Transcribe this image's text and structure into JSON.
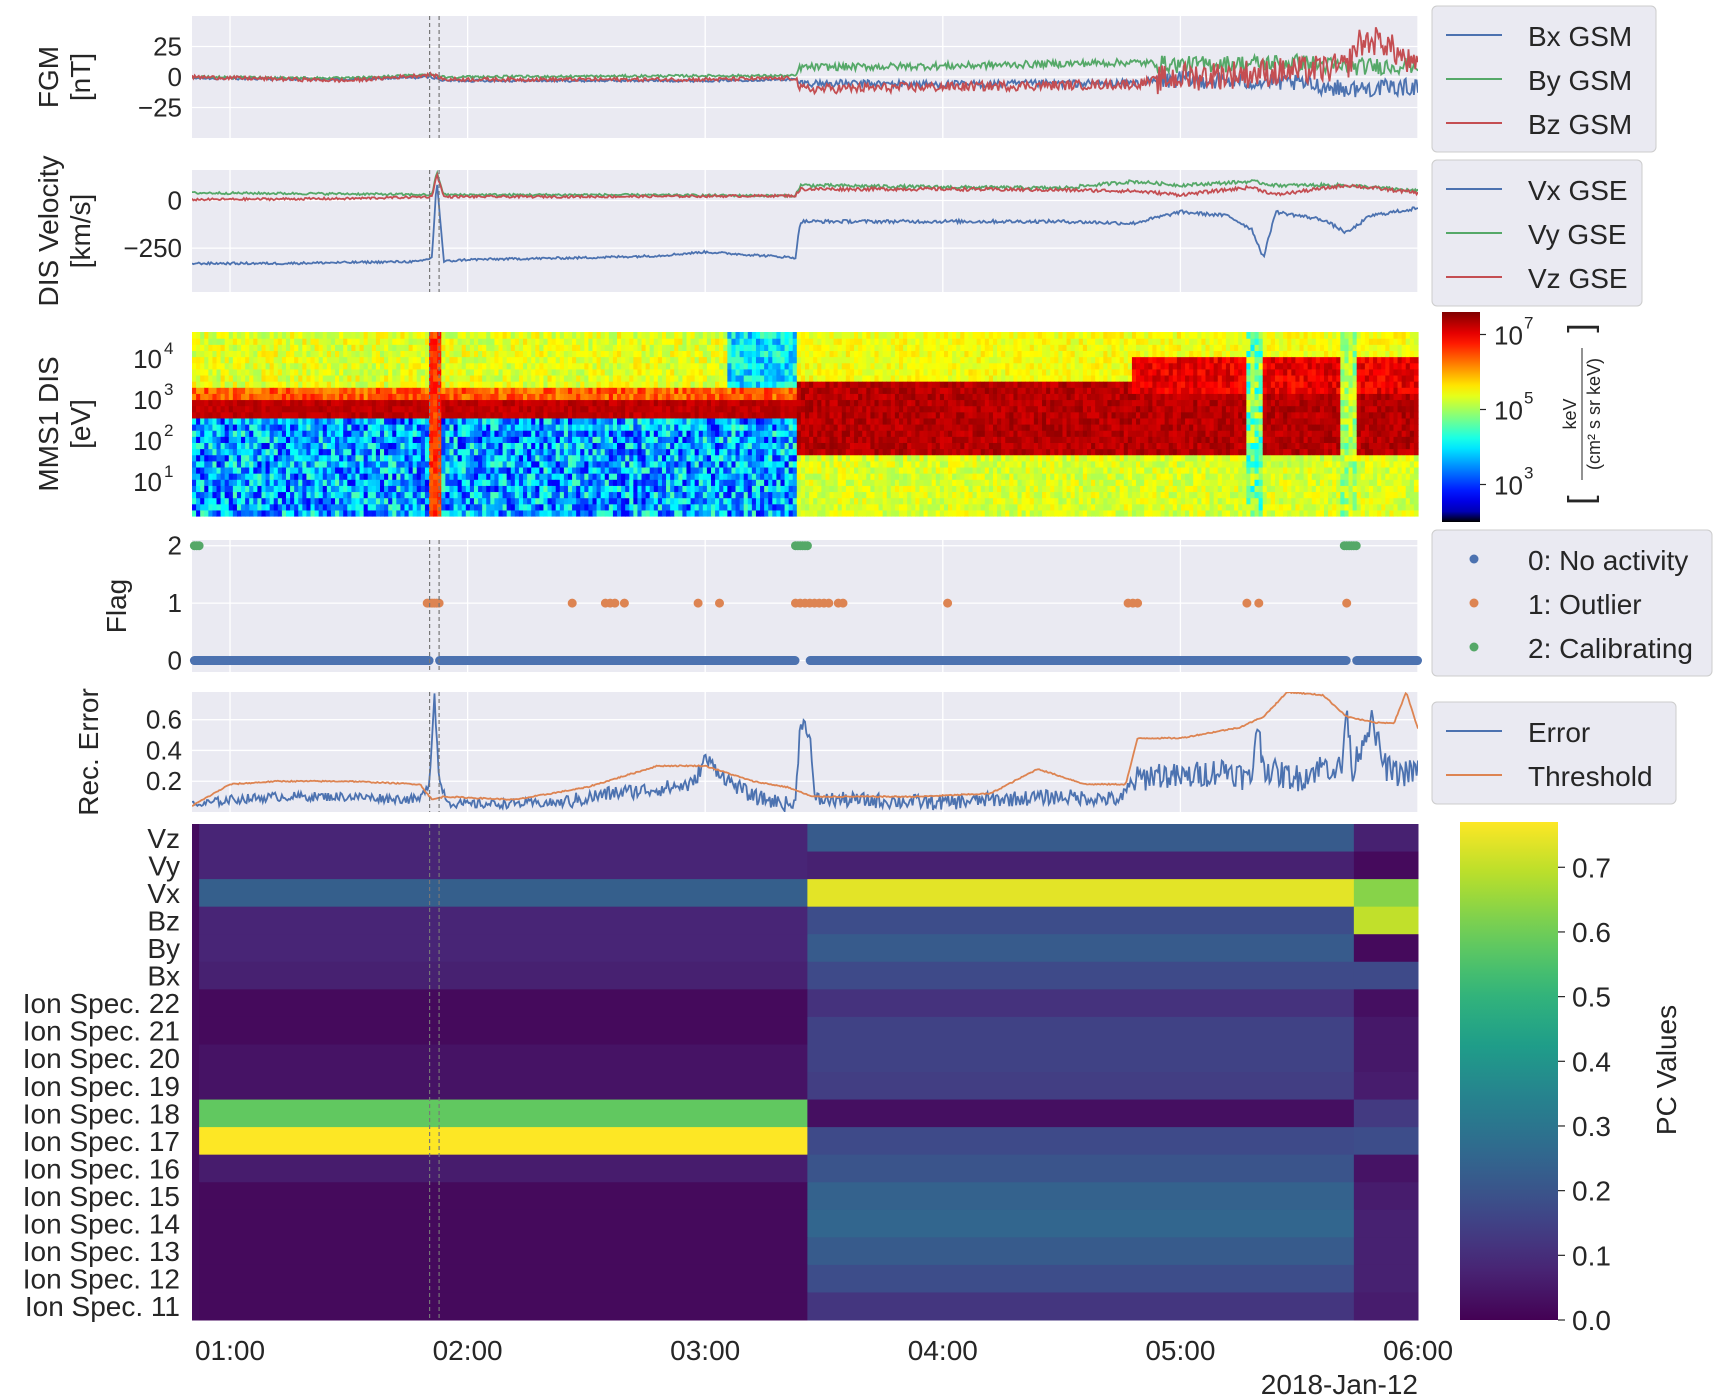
{
  "chart_data": {
    "type": "multi-panel",
    "date_label": "2018-Jan-12",
    "x_range_hours": [
      0.84,
      6.0
    ],
    "x_ticks": [
      {
        "hour": 1,
        "label": "01:00"
      },
      {
        "hour": 2,
        "label": "02:00"
      },
      {
        "hour": 3,
        "label": "03:00"
      },
      {
        "hour": 4,
        "label": "04:00"
      },
      {
        "hour": 5,
        "label": "05:00"
      },
      {
        "hour": 6,
        "label": "06:00"
      }
    ],
    "event_markers_hours": [
      1.84,
      1.88
    ],
    "panels": {
      "fgm": {
        "type": "line",
        "ylabel": [
          "FGM",
          "[nT]"
        ],
        "ylim": [
          -50,
          50
        ],
        "yticks": [
          {
            "v": 25,
            "label": "25"
          },
          {
            "v": 0,
            "label": "0"
          },
          {
            "v": -25,
            "label": "−25"
          }
        ],
        "series": [
          {
            "name": "Bx GSM",
            "color": "#4c72b0",
            "x": [
              0.84,
              1.5,
              1.85,
              1.9,
              3.0,
              3.38,
              3.4,
              4.0,
              4.8,
              5.0,
              5.5,
              5.7,
              6.0
            ],
            "y": [
              -1,
              -2,
              0,
              -3,
              -3,
              -2,
              -5,
              -6,
              -5,
              -2,
              -5,
              -10,
              -8
            ]
          },
          {
            "name": "By GSM",
            "color": "#55a868",
            "x": [
              0.84,
              1.5,
              1.85,
              1.9,
              3.0,
              3.38,
              3.4,
              4.0,
              4.8,
              5.0,
              5.5,
              5.7,
              6.0
            ],
            "y": [
              0,
              -1,
              2,
              0,
              1,
              1,
              8,
              9,
              12,
              10,
              12,
              8,
              10
            ]
          },
          {
            "name": "Bz GSM",
            "color": "#c44e52",
            "x": [
              0.84,
              1.5,
              1.85,
              1.9,
              3.0,
              3.38,
              3.4,
              4.0,
              4.8,
              5.0,
              5.5,
              5.7,
              5.75,
              5.85,
              6.0
            ],
            "y": [
              0,
              -3,
              2,
              -2,
              -2,
              -1,
              -10,
              -8,
              -6,
              0,
              5,
              8,
              28,
              30,
              5
            ]
          }
        ]
      },
      "velocity": {
        "type": "line",
        "ylabel": [
          "DIS Velocity",
          "[km/s]"
        ],
        "ylim": [
          -480,
          160
        ],
        "yticks": [
          {
            "v": 0,
            "label": "0"
          },
          {
            "v": -250,
            "label": "−250"
          }
        ],
        "series": [
          {
            "name": "Vx GSE",
            "color": "#4c72b0",
            "x": [
              0.84,
              1.2,
              1.5,
              1.8,
              1.85,
              1.87,
              1.9,
              2.0,
              2.5,
              2.8,
              3.0,
              3.38,
              3.4,
              3.8,
              4.5,
              4.8,
              5.0,
              5.2,
              5.3,
              5.35,
              5.4,
              5.6,
              5.7,
              5.8,
              6.0
            ],
            "y": [
              -330,
              -330,
              -325,
              -320,
              -300,
              110,
              -320,
              -310,
              -300,
              -290,
              -270,
              -300,
              -110,
              -110,
              -110,
              -120,
              -60,
              -80,
              -150,
              -300,
              -60,
              -100,
              -170,
              -80,
              -40
            ]
          },
          {
            "name": "Vy GSE",
            "color": "#55a868",
            "x": [
              0.84,
              1.5,
              1.85,
              1.87,
              1.9,
              2.5,
              3.38,
              3.4,
              4.0,
              4.5,
              4.8,
              5.0,
              5.3,
              5.4,
              5.7,
              6.0
            ],
            "y": [
              40,
              35,
              30,
              150,
              30,
              30,
              25,
              80,
              70,
              65,
              100,
              80,
              100,
              80,
              80,
              50
            ]
          },
          {
            "name": "Vz GSE",
            "color": "#c44e52",
            "x": [
              0.84,
              1.5,
              1.85,
              1.87,
              1.9,
              2.5,
              3.38,
              3.4,
              4.0,
              4.5,
              4.8,
              5.0,
              5.3,
              5.4,
              5.7,
              6.0
            ],
            "y": [
              5,
              10,
              20,
              140,
              20,
              20,
              25,
              60,
              60,
              55,
              50,
              30,
              70,
              30,
              80,
              40
            ]
          }
        ]
      },
      "spectrogram": {
        "type": "heatmap",
        "ylabel": [
          "MMS1 DIS",
          "[eV]"
        ],
        "ylim_log10": [
          0.18,
          4.65
        ],
        "yticks": [
          {
            "v": 1,
            "base": "10",
            "exp": "1"
          },
          {
            "v": 2,
            "base": "10",
            "exp": "2"
          },
          {
            "v": 3,
            "base": "10",
            "exp": "3"
          },
          {
            "v": 4,
            "base": "10",
            "exp": "4"
          }
        ],
        "cbar_log10": [
          2.0,
          7.6
        ],
        "cbar_ticks": [
          {
            "v": 3,
            "base": "10",
            "exp": "3"
          },
          {
            "v": 5,
            "base": "10",
            "exp": "5"
          },
          {
            "v": 7,
            "base": "10",
            "exp": "7"
          }
        ],
        "cbar_label": {
          "bracket_open": "[",
          "numerator": "keV",
          "denominator": "(cm² s sr keV)",
          "bracket_close": "]"
        },
        "colormap": "jet-with-black-bottom",
        "regimes": [
          {
            "start": 0.84,
            "end": 3.38,
            "description": "mixed low-energy background with narrow intense band near 600 eV"
          },
          {
            "start": 3.38,
            "end": 6.0,
            "description": "broad intense band 30–3000 eV"
          }
        ]
      },
      "flag": {
        "type": "scatter",
        "ylabel": [
          "Flag"
        ],
        "ylim": [
          -0.2,
          2.1
        ],
        "yticks": [
          {
            "v": 2,
            "label": "2"
          },
          {
            "v": 1,
            "label": "1"
          },
          {
            "v": 0,
            "label": "0"
          }
        ],
        "legend": [
          {
            "name": "0: No activity",
            "color": "#4c72b0"
          },
          {
            "name": "1: Outlier",
            "color": "#dd8452"
          },
          {
            "name": "2: Calibrating",
            "color": "#55a868"
          }
        ],
        "no_activity_gaps": [
          [
            1.84,
            1.88
          ],
          [
            3.38,
            3.44
          ],
          [
            5.7,
            5.74
          ]
        ],
        "outliers": [
          1.83,
          1.84,
          1.85,
          1.86,
          1.87,
          1.88,
          2.44,
          2.58,
          2.6,
          2.62,
          2.66,
          2.97,
          3.06,
          3.38,
          3.4,
          3.42,
          3.44,
          3.46,
          3.48,
          3.5,
          3.52,
          3.56,
          3.58,
          4.02,
          4.78,
          4.8,
          4.82,
          5.28,
          5.33,
          5.7
        ],
        "calibrating": [
          0.85,
          0.86,
          0.87,
          3.38,
          3.39,
          3.4,
          3.41,
          3.42,
          3.43,
          5.69,
          5.7,
          5.71,
          5.72,
          5.73,
          5.74
        ]
      },
      "error": {
        "type": "line",
        "ylabel": [
          "Rec. Error"
        ],
        "ylim": [
          0.0,
          0.78
        ],
        "yticks": [
          {
            "v": 0.6,
            "label": "0.6"
          },
          {
            "v": 0.4,
            "label": "0.4"
          },
          {
            "v": 0.2,
            "label": "0.2"
          }
        ],
        "series": [
          {
            "name": "Error",
            "color": "#4c72b0",
            "x": [
              0.84,
              1.0,
              1.2,
              1.5,
              1.8,
              1.84,
              1.86,
              1.88,
              1.92,
              2.0,
              2.4,
              2.6,
              2.8,
              2.95,
              3.0,
              3.1,
              3.2,
              3.35,
              3.38,
              3.4,
              3.44,
              3.46,
              3.6,
              4.0,
              4.2,
              4.5,
              4.76,
              4.8,
              4.9,
              5.0,
              5.2,
              5.3,
              5.32,
              5.35,
              5.4,
              5.5,
              5.6,
              5.68,
              5.7,
              5.72,
              5.74,
              5.8,
              5.86,
              5.9,
              6.0
            ],
            "y": [
              0.04,
              0.08,
              0.1,
              0.1,
              0.08,
              0.2,
              0.78,
              0.2,
              0.06,
              0.05,
              0.06,
              0.12,
              0.15,
              0.18,
              0.35,
              0.2,
              0.1,
              0.05,
              0.05,
              0.6,
              0.52,
              0.08,
              0.08,
              0.06,
              0.08,
              0.1,
              0.08,
              0.2,
              0.25,
              0.22,
              0.28,
              0.2,
              0.6,
              0.3,
              0.25,
              0.22,
              0.3,
              0.28,
              0.72,
              0.25,
              0.35,
              0.6,
              0.3,
              0.25,
              0.26
            ]
          },
          {
            "name": "Threshold",
            "color": "#dd8452",
            "x": [
              0.84,
              1.0,
              1.2,
              1.5,
              1.8,
              1.85,
              1.9,
              2.2,
              2.5,
              2.8,
              3.0,
              3.2,
              3.35,
              3.45,
              3.6,
              3.9,
              4.2,
              4.4,
              4.6,
              4.77,
              4.82,
              5.0,
              5.25,
              5.35,
              5.45,
              5.6,
              5.7,
              5.82,
              5.9,
              5.95,
              6.0
            ],
            "y": [
              0.04,
              0.18,
              0.2,
              0.2,
              0.18,
              0.08,
              0.1,
              0.08,
              0.16,
              0.3,
              0.3,
              0.2,
              0.16,
              0.1,
              0.1,
              0.1,
              0.12,
              0.28,
              0.18,
              0.18,
              0.48,
              0.48,
              0.55,
              0.62,
              0.78,
              0.76,
              0.62,
              0.58,
              0.58,
              0.78,
              0.54
            ]
          }
        ]
      },
      "pc": {
        "type": "heatmap",
        "row_labels": [
          "Vz",
          "Vy",
          "Vx",
          "Bz",
          "By",
          "Bx",
          "Ion Spec. 22",
          "Ion Spec. 21",
          "Ion Spec. 20",
          "Ion Spec. 19",
          "Ion Spec. 18",
          "Ion Spec. 17",
          "Ion Spec. 16",
          "Ion Spec. 15",
          "Ion Spec. 14",
          "Ion Spec. 13",
          "Ion Spec. 12",
          "Ion Spec. 11"
        ],
        "segments": [
          0.87,
          3.43,
          5.73,
          6.0
        ],
        "edge_strip": [
          0.84,
          0.87
        ],
        "values": [
          [
            0.08,
            0.22,
            0.07
          ],
          [
            0.08,
            0.07,
            0.02
          ],
          [
            0.23,
            0.74,
            0.63
          ],
          [
            0.08,
            0.18,
            0.7
          ],
          [
            0.08,
            0.22,
            0.02
          ],
          [
            0.07,
            0.17,
            0.17
          ],
          [
            0.02,
            0.11,
            0.03
          ],
          [
            0.02,
            0.15,
            0.05
          ],
          [
            0.04,
            0.15,
            0.05
          ],
          [
            0.04,
            0.14,
            0.06
          ],
          [
            0.58,
            0.03,
            0.13
          ],
          [
            0.77,
            0.17,
            0.18
          ],
          [
            0.06,
            0.2,
            0.04
          ],
          [
            0.02,
            0.24,
            0.06
          ],
          [
            0.02,
            0.25,
            0.07
          ],
          [
            0.02,
            0.22,
            0.07
          ],
          [
            0.02,
            0.18,
            0.07
          ],
          [
            0.02,
            0.12,
            0.06
          ]
        ],
        "cbar_range": [
          0.0,
          0.77
        ],
        "cbar_ticks": [
          {
            "v": 0.7,
            "label": "0.7"
          },
          {
            "v": 0.6,
            "label": "0.6"
          },
          {
            "v": 0.5,
            "label": "0.5"
          },
          {
            "v": 0.4,
            "label": "0.4"
          },
          {
            "v": 0.3,
            "label": "0.3"
          },
          {
            "v": 0.2,
            "label": "0.2"
          },
          {
            "v": 0.1,
            "label": "0.1"
          },
          {
            "v": 0.0,
            "label": "0.0"
          }
        ],
        "cbar_label": "PC Values",
        "colormap": "viridis"
      }
    },
    "colors": {
      "axes_bg": "#eaeaf2",
      "grid": "#ffffff",
      "text": "#262626",
      "marker": "#777777"
    }
  }
}
